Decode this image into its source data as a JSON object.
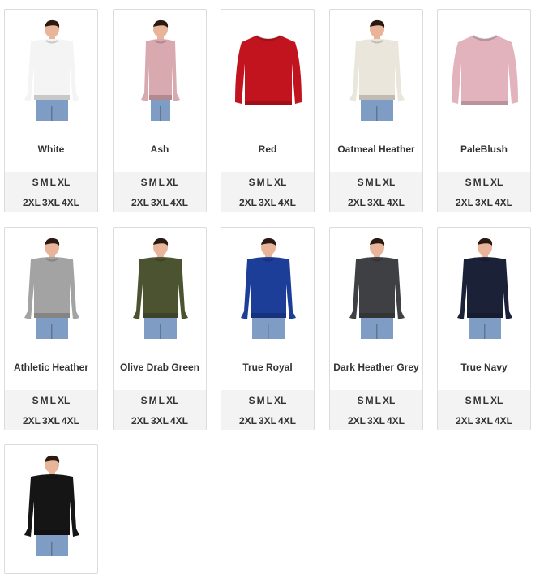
{
  "products": [
    {
      "name": "White",
      "color": "#f4f4f4",
      "style": "model"
    },
    {
      "name": "Ash",
      "color": "#d8a9af",
      "style": "model-side"
    },
    {
      "name": "Red",
      "color": "#c2141f",
      "style": "flat"
    },
    {
      "name": "Oatmeal Heather",
      "color": "#ebe6dc",
      "style": "model"
    },
    {
      "name": "PaleBlush",
      "color": "#e3b3bd",
      "style": "flat"
    },
    {
      "name": "Athletic Heather",
      "color": "#a3a3a3",
      "style": "model"
    },
    {
      "name": "Olive Drab Green",
      "color": "#4b5330",
      "style": "model"
    },
    {
      "name": "True Royal",
      "color": "#1c3e98",
      "style": "model"
    },
    {
      "name": "Dark Heather Grey",
      "color": "#3e4043",
      "style": "model"
    },
    {
      "name": "True Navy",
      "color": "#1b2238",
      "style": "model"
    },
    {
      "name": "",
      "color": "#151515",
      "style": "model"
    }
  ],
  "sizes_row1": [
    "S",
    "M",
    "L",
    "XL"
  ],
  "sizes_row2": [
    "2XL",
    "3XL",
    "4XL"
  ]
}
